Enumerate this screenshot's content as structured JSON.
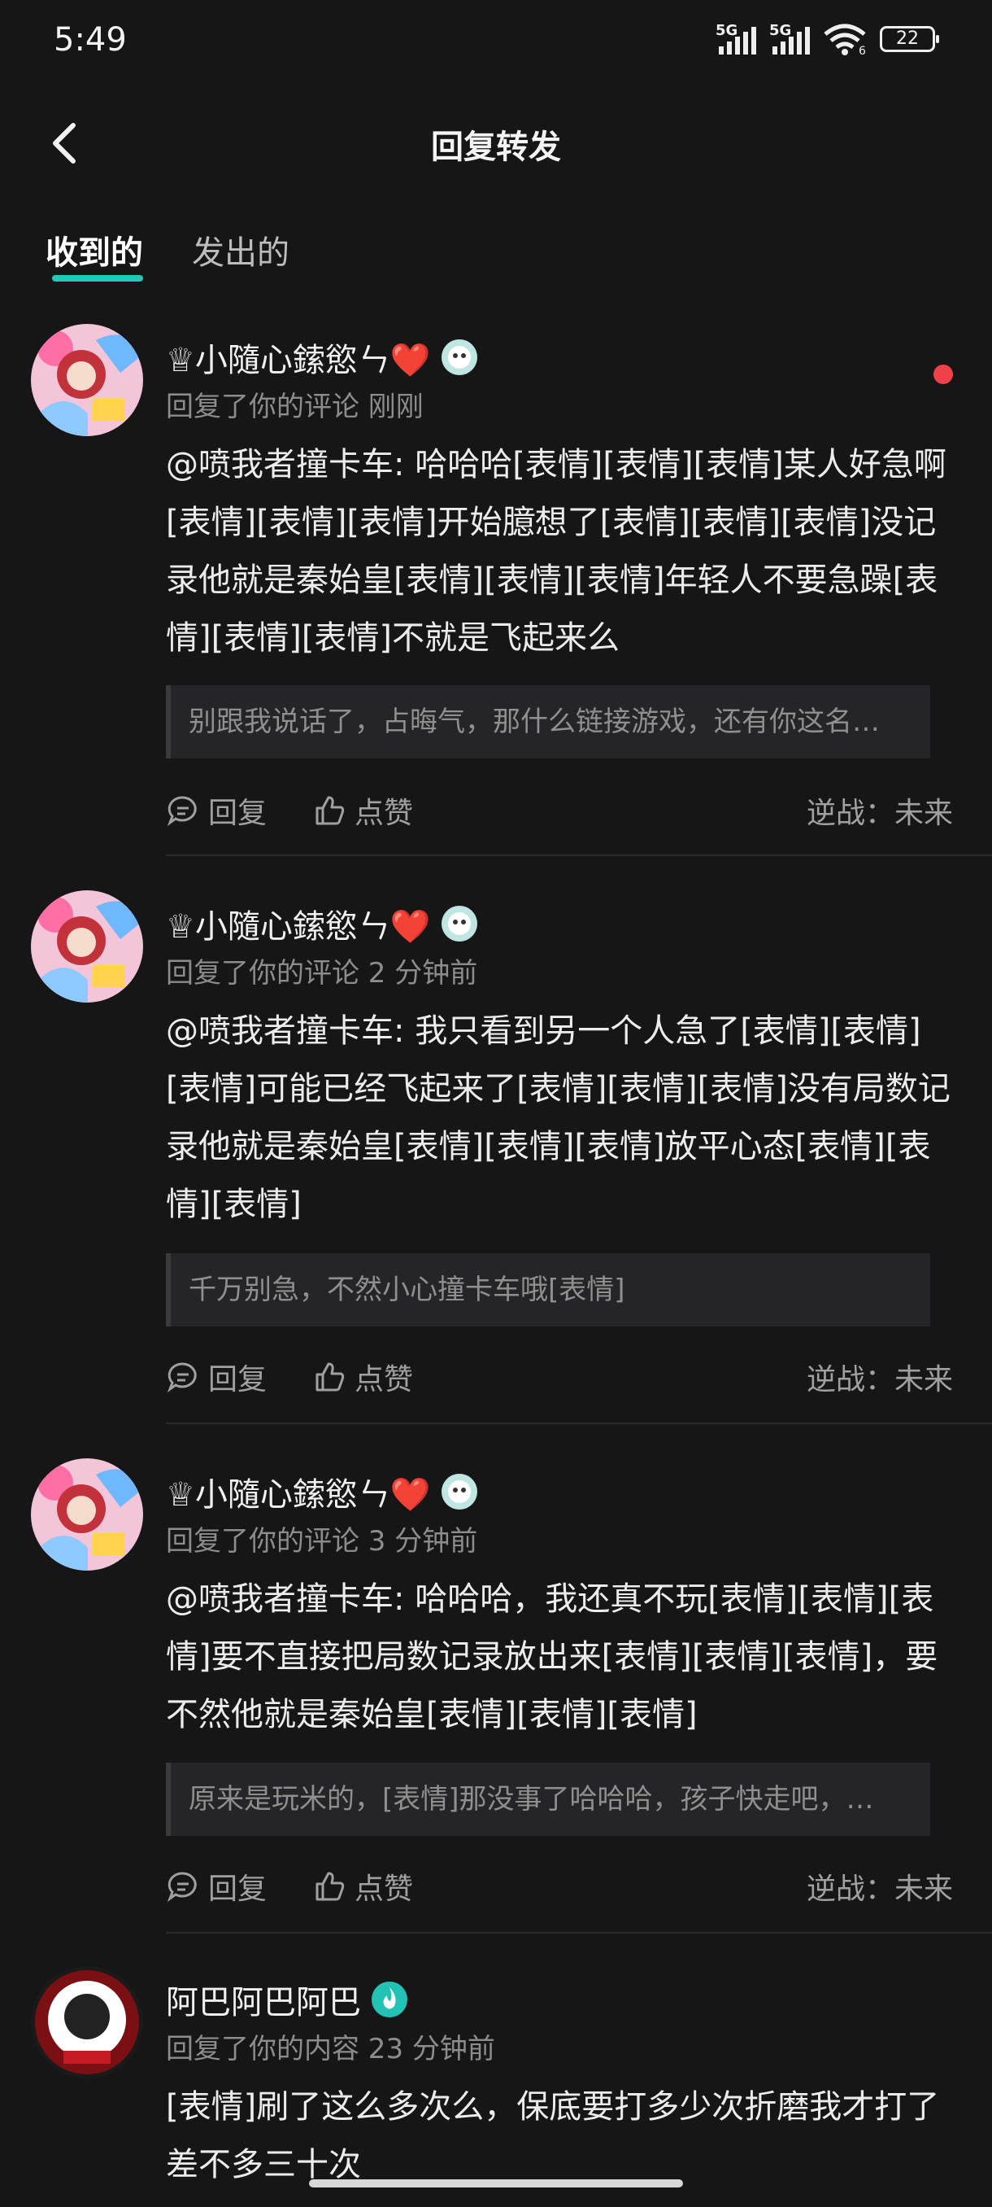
{
  "status": {
    "time": "5:49",
    "network1": "5G",
    "network2": "5G",
    "wifi_badge": "6",
    "battery": "22"
  },
  "header": {
    "title": "回复转发"
  },
  "tabs": [
    {
      "label": "收到的"
    },
    {
      "label": "发出的"
    }
  ],
  "replies": [
    {
      "username": "♕小隨心鎍慾ㄣ❤️",
      "meta": "回复了你的评论 刚刚",
      "content": "@喷我者撞卡车: 哈哈哈[表情][表情][表情]某人好急啊[表情][表情][表情]开始臆想了[表情][表情][表情]没记录他就是秦始皇[表情][表情][表情]年轻人不要急躁[表情][表情][表情]不就是飞起来么",
      "quote": "别跟我说话了，占晦气，那什么链接游戏，还有你这名…",
      "reply_label": "回复",
      "like_label": "点赞",
      "source": "逆战：未来",
      "unread": true
    },
    {
      "username": "♕小隨心鎍慾ㄣ❤️",
      "meta": "回复了你的评论 2 分钟前",
      "content": "@喷我者撞卡车: 我只看到另一个人急了[表情][表情][表情]可能已经飞起来了[表情][表情][表情]没有局数记录他就是秦始皇[表情][表情][表情]放平心态[表情][表情][表情]",
      "quote": "千万别急，不然小心撞卡车哦[表情]",
      "reply_label": "回复",
      "like_label": "点赞",
      "source": "逆战：未来"
    },
    {
      "username": "♕小隨心鎍慾ㄣ❤️",
      "meta": "回复了你的评论 3 分钟前",
      "content": "@喷我者撞卡车: 哈哈哈，我还真不玩[表情][表情][表情]要不直接把局数记录放出来[表情][表情][表情]，要不然他就是秦始皇[表情][表情][表情]",
      "quote": "原来是玩米的，[表情]那没事了哈哈哈，孩子快走吧，…",
      "reply_label": "回复",
      "like_label": "点赞",
      "source": "逆战：未来"
    },
    {
      "username": "阿巴阿巴阿巴",
      "meta": "回复了你的内容 23 分钟前",
      "content": "[表情]刷了这么多次么，保底要打多少次折磨我才打了差不多三十次"
    }
  ]
}
